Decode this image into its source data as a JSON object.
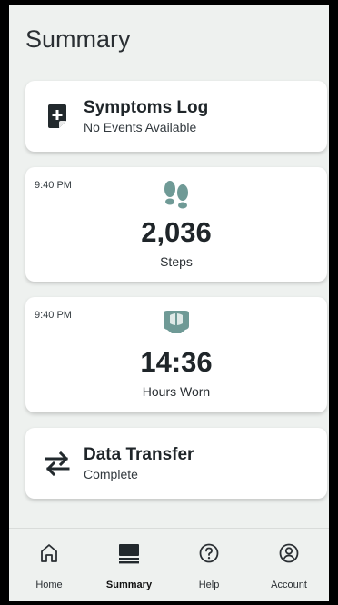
{
  "page": {
    "title": "Summary"
  },
  "cards": {
    "symptoms": {
      "title": "Symptoms Log",
      "subtitle": "No Events Available",
      "icon": "note-add-icon"
    },
    "steps": {
      "time": "9:40 PM",
      "value": "2,036",
      "unit": "Steps",
      "icon": "footsteps-icon",
      "icon_color": "#6f9a96"
    },
    "worn": {
      "time": "9:40 PM",
      "value": "14:36",
      "unit": "Hours Worn",
      "icon": "brace-icon",
      "icon_color": "#6f9a96"
    },
    "transfer": {
      "title": "Data Transfer",
      "subtitle": "Complete",
      "icon": "swap-arrows-icon"
    }
  },
  "nav": {
    "items": [
      {
        "label": "Home",
        "icon": "home-icon"
      },
      {
        "label": "Summary",
        "icon": "summary-icon",
        "active": true
      },
      {
        "label": "Help",
        "icon": "help-icon"
      },
      {
        "label": "Account",
        "icon": "account-icon"
      }
    ]
  }
}
